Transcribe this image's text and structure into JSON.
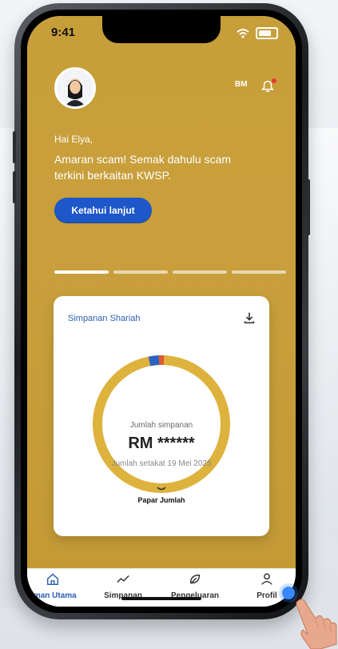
{
  "status_bar": {
    "time": "9:41"
  },
  "header": {
    "language": "BM"
  },
  "hero": {
    "greeting": "Hai Elya,",
    "message": "Amaran scam! Semak dahulu scam terkini berkaitan KWSP.",
    "cta_label": "Ketahui lanjut",
    "slides_total": 4,
    "active_slide": 1
  },
  "card": {
    "title": "Simpanan Shariah",
    "ring_label": "Jumlah simpanan",
    "amount": "RM ******",
    "as_of": "Jumlah setakat 19 Mei 2025",
    "show_label": "Papar Jumlah"
  },
  "bottom_nav": {
    "items": [
      {
        "label": "aman Utama",
        "icon": "home-icon",
        "active": true
      },
      {
        "label": "Simpanan",
        "icon": "trend-icon",
        "active": false
      },
      {
        "label": "Pengeluaran",
        "icon": "leaf-icon",
        "active": false
      },
      {
        "label": "Profil",
        "icon": "user-icon",
        "active": false
      }
    ]
  },
  "colors": {
    "gold": "#C79F3A",
    "blue": "#1D57C9",
    "ring_gold": "#DDB23D",
    "ring_red": "#E05A2F",
    "ring_blue": "#2D62C4"
  }
}
